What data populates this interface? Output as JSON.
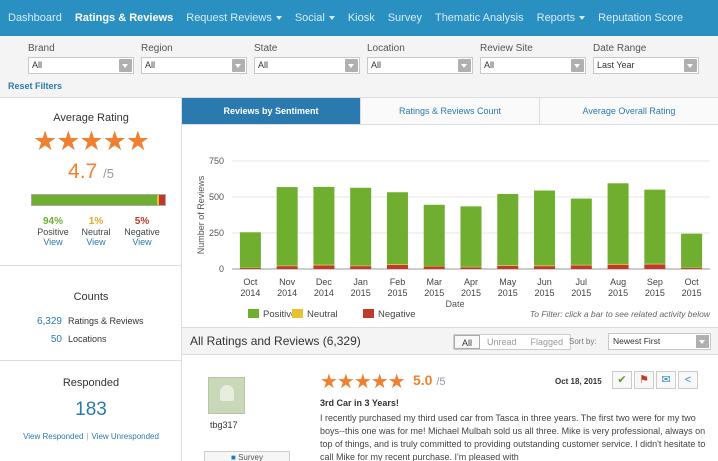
{
  "nav": {
    "items": [
      {
        "label": "Dashboard",
        "dropdown": false,
        "active": false
      },
      {
        "label": "Ratings & Reviews",
        "dropdown": false,
        "active": true
      },
      {
        "label": "Request Reviews",
        "dropdown": true,
        "active": false
      },
      {
        "label": "Social",
        "dropdown": true,
        "active": false
      },
      {
        "label": "Kiosk",
        "dropdown": false,
        "active": false
      },
      {
        "label": "Survey",
        "dropdown": false,
        "active": false
      },
      {
        "label": "Thematic Analysis",
        "dropdown": false,
        "active": false
      },
      {
        "label": "Reports",
        "dropdown": true,
        "active": false
      },
      {
        "label": "Reputation Score",
        "dropdown": false,
        "active": false
      }
    ]
  },
  "filters": {
    "brand": {
      "label": "Brand",
      "value": "All"
    },
    "region": {
      "label": "Region",
      "value": "All"
    },
    "state": {
      "label": "State",
      "value": "All"
    },
    "location": {
      "label": "Location",
      "value": "All"
    },
    "review_site": {
      "label": "Review Site",
      "value": "All"
    },
    "date_range": {
      "label": "Date Range",
      "value": "Last Year"
    },
    "reset": "Reset Filters"
  },
  "average": {
    "title": "Average Rating",
    "stars": "★★★★★",
    "value": "4.7",
    "out_of": "/5",
    "positive": {
      "pct": "94%",
      "label": "Positive",
      "link": "View"
    },
    "neutral": {
      "pct": "1%",
      "label": "Neutral",
      "link": "View"
    },
    "negative": {
      "pct": "5%",
      "label": "Negative",
      "link": "View"
    },
    "colors": {
      "positive": "#6fae2e",
      "neutral": "#e8c230",
      "negative": "#c0392b"
    }
  },
  "counts": {
    "title": "Counts",
    "reviews": {
      "value": "6,329",
      "label": "Ratings & Reviews"
    },
    "locations": {
      "value": "50",
      "label": "Locations"
    }
  },
  "responded": {
    "title": "Responded",
    "value": "183",
    "link_responded": "View Responded",
    "link_unresponded": "View Unresponded"
  },
  "tabs": {
    "sentiment": "Reviews by Sentiment",
    "count": "Ratings & Reviews Count",
    "overall": "Average Overall Rating"
  },
  "chart_data": {
    "type": "bar",
    "stacked": true,
    "xlabel": "Date",
    "ylabel": "Number of Reviews",
    "ylim": [
      0,
      750
    ],
    "yticks": [
      0,
      250,
      500,
      750
    ],
    "grid": true,
    "categories": [
      [
        "Oct",
        "2014"
      ],
      [
        "Nov",
        "2014"
      ],
      [
        "Dec",
        "2014"
      ],
      [
        "Jan",
        "2015"
      ],
      [
        "Feb",
        "2015"
      ],
      [
        "Mar",
        "2015"
      ],
      [
        "Apr",
        "2015"
      ],
      [
        "May",
        "2015"
      ],
      [
        "Jun",
        "2015"
      ],
      [
        "Jul",
        "2015"
      ],
      [
        "Aug",
        "2015"
      ],
      [
        "Sep",
        "2015"
      ],
      [
        "Oct",
        "2015"
      ]
    ],
    "series": [
      {
        "name": "Positive",
        "color": "#6fae2e",
        "values": [
          245,
          545,
          540,
          540,
          500,
          425,
          420,
          495,
          520,
          460,
          560,
          515,
          235
        ]
      },
      {
        "name": "Neutral",
        "color": "#e8c230",
        "values": [
          2,
          4,
          5,
          4,
          5,
          3,
          3,
          4,
          5,
          4,
          5,
          4,
          2
        ]
      },
      {
        "name": "Negative",
        "color": "#c0392b",
        "values": [
          8,
          20,
          25,
          20,
          28,
          18,
          12,
          22,
          20,
          25,
          30,
          32,
          8
        ]
      }
    ],
    "legend_position": "bottom-left",
    "filter_hint": "To Filter:  click a bar to see related activity below"
  },
  "reviews": {
    "header": "All Ratings and Reviews (6,329)",
    "seg_all": "All",
    "seg_unread": "Unread",
    "seg_flagged": "Flagged",
    "sort_label": "Sort by:",
    "sort_value": "Newest First",
    "item": {
      "user": "tbg317",
      "survey": "Survey",
      "stars": "★★★★★",
      "score": "5.0",
      "out_of": "/5",
      "date": "Oct 18, 2015",
      "headline": "3rd Car in 3 Years!",
      "body": "I recently purchased my third used car from Tasca in three years. The first two were for my two boys--this one was for me! Michael Mulbah sold us all three. Mike is very professional, always on top of things, and is truly committed to providing outstanding customer service. I didn't hesitate to call Mike for my recent purchase. I'm pleased with"
    }
  }
}
